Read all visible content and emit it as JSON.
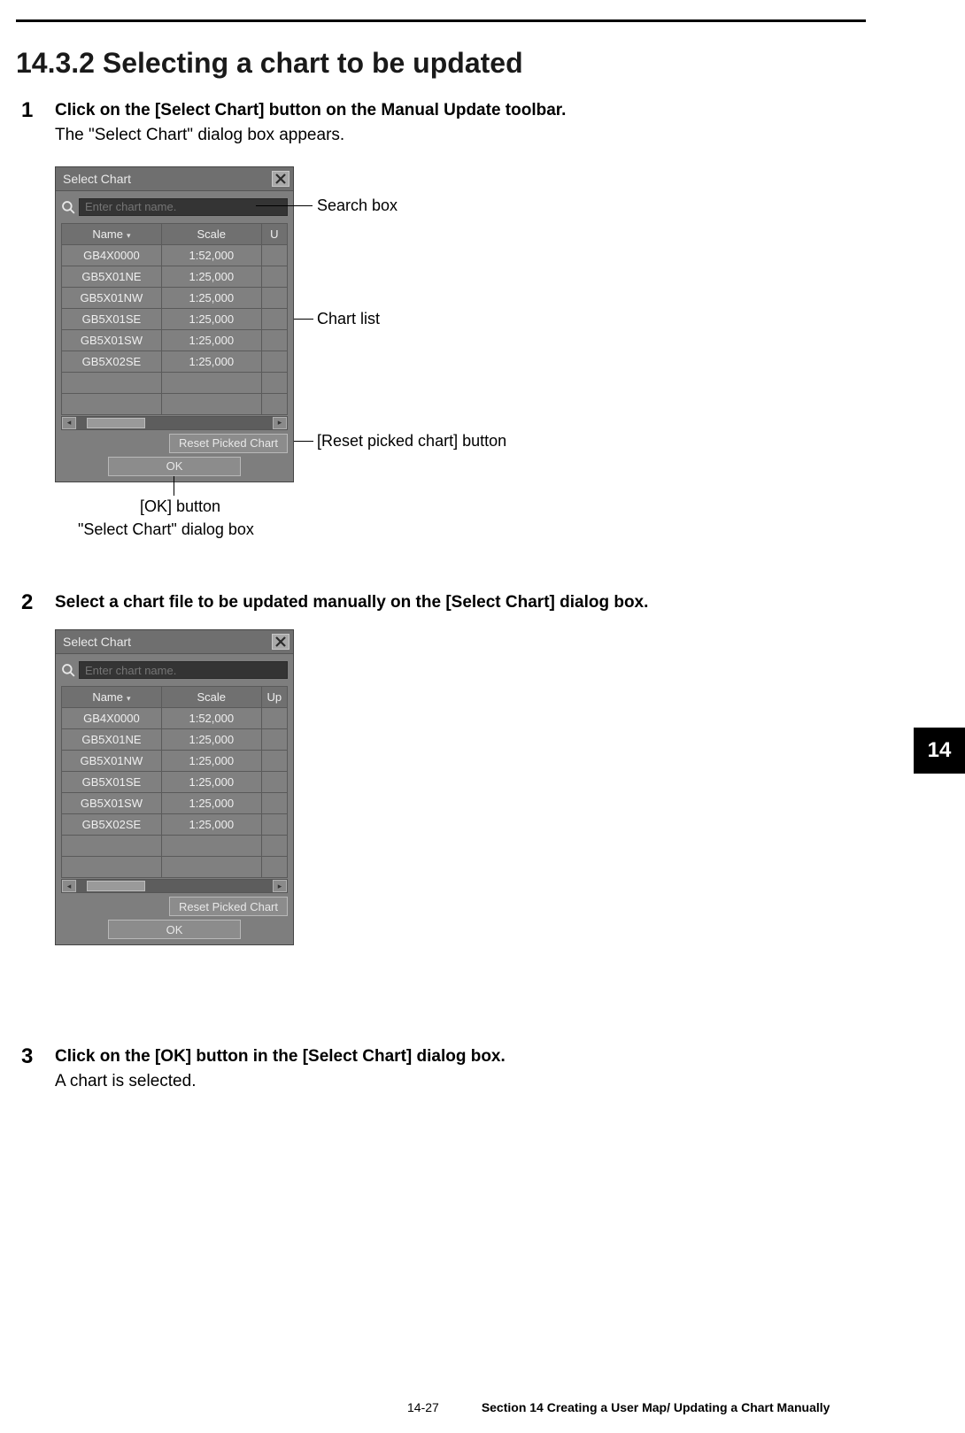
{
  "heading": "14.3.2   Selecting a chart to be updated",
  "steps": {
    "s1": {
      "num": "1",
      "lead": "Click on the [Select Chart] button on the Manual Update toolbar.",
      "sub": "The \"Select Chart\" dialog box appears."
    },
    "s2": {
      "num": "2",
      "lead": "Select a chart file to be updated manually on the [Select Chart] dialog box."
    },
    "s3": {
      "num": "3",
      "lead": "Click on the [OK] button in the [Select Chart] dialog box.",
      "sub": "A chart is selected."
    }
  },
  "dialog": {
    "title": "Select Chart",
    "search_placeholder": "Enter chart name.",
    "headers": {
      "name": "Name",
      "scale": "Scale",
      "u": "U"
    },
    "headers2": {
      "u": "Up"
    },
    "rows": [
      {
        "name": "GB4X0000",
        "scale": "1:52,000"
      },
      {
        "name": "GB5X01NE",
        "scale": "1:25,000"
      },
      {
        "name": "GB5X01NW",
        "scale": "1:25,000"
      },
      {
        "name": "GB5X01SE",
        "scale": "1:25,000"
      },
      {
        "name": "GB5X01SW",
        "scale": "1:25,000"
      },
      {
        "name": "GB5X02SE",
        "scale": "1:25,000"
      }
    ],
    "reset_label": "Reset Picked Chart",
    "ok_label": "OK"
  },
  "annotations": {
    "search": "Search box",
    "list": "Chart list",
    "reset": "[Reset picked chart] button",
    "ok": "[OK] button",
    "caption": "\"Select Chart\" dialog box"
  },
  "side_tab": "14",
  "footer": {
    "page": "14-27",
    "section": "Section 14    Creating a User Map/ Updating a Chart Manually"
  }
}
